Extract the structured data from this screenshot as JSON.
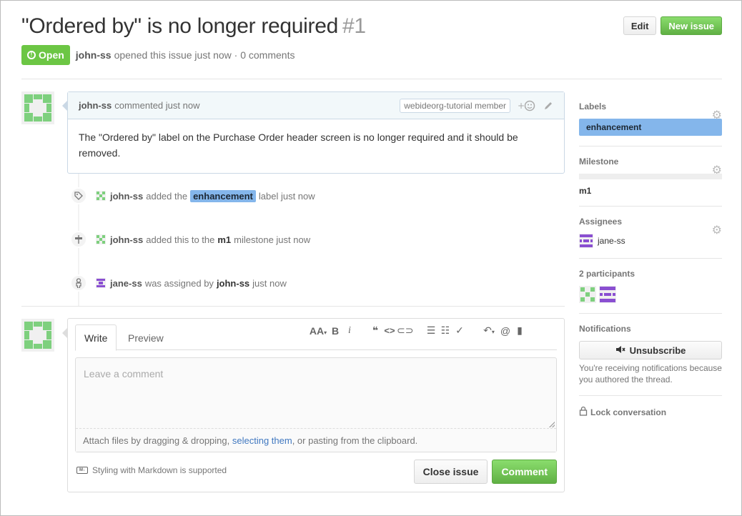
{
  "issue": {
    "title": "\"Ordered by\" is no longer required",
    "number": "#1",
    "state": "Open",
    "author": "john-ss",
    "opened_text": "opened this issue just now · 0 comments",
    "edit_label": "Edit",
    "new_issue_label": "New issue"
  },
  "comment": {
    "author": "john-ss",
    "time_text": "commented just now",
    "badge": "webideorg-tutorial member",
    "body": "The \"Ordered by\" label on the Purchase Order header screen is no longer required and it should be removed."
  },
  "events": [
    {
      "actor": "john-ss",
      "pre": "added the",
      "label": "enhancement",
      "post": "label just now"
    },
    {
      "actor": "john-ss",
      "pre": "added this to the",
      "milestone": "m1",
      "post": "milestone just now"
    },
    {
      "actor": "jane-ss",
      "pre": "was assigned by",
      "by": "john-ss",
      "post": "just now"
    }
  ],
  "form": {
    "tab_write": "Write",
    "tab_preview": "Preview",
    "placeholder": "Leave a comment",
    "drop_pre": "Attach files by dragging & dropping, ",
    "drop_link": "selecting them",
    "drop_post": ", or pasting from the clipboard.",
    "markdown_note": "Styling with Markdown is supported",
    "close_label": "Close issue",
    "comment_label": "Comment"
  },
  "sidebar": {
    "labels_heading": "Labels",
    "label": "enhancement",
    "label_color": "#84b6eb",
    "milestone_heading": "Milestone",
    "milestone_progress": 0,
    "milestone": "m1",
    "assignees_heading": "Assignees",
    "assignee": "jane-ss",
    "participants_heading": "2 participants",
    "notifications_heading": "Notifications",
    "unsubscribe_label": "Unsubscribe",
    "notif_text": "You're receiving notifications because you authored the thread.",
    "lock_label": "Lock conversation"
  },
  "colors": {
    "open_green": "#6cc644",
    "identicon_green": "#7ed07e",
    "identicon_purple": "#8a4fd1"
  }
}
